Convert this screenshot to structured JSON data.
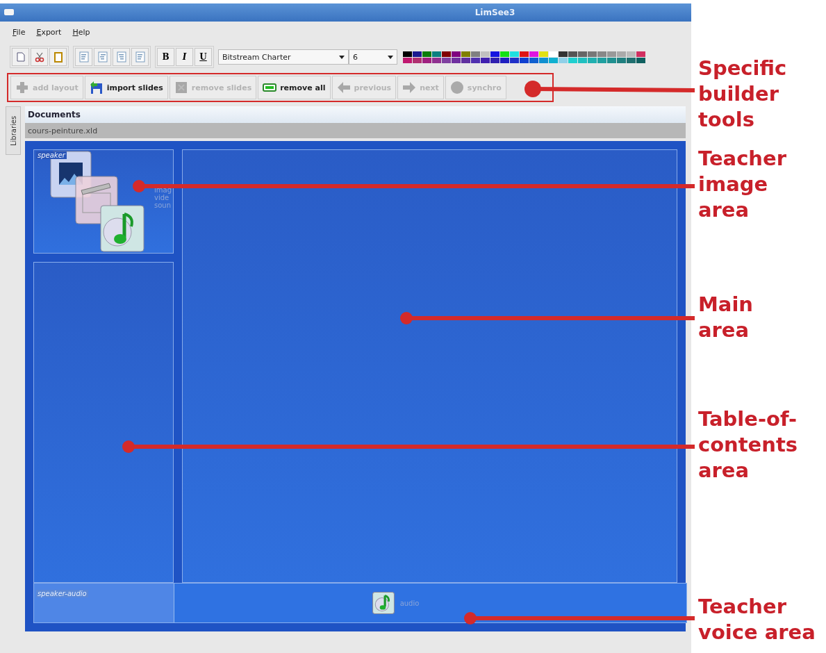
{
  "window": {
    "title": "LimSee3"
  },
  "menu": [
    {
      "label": "File"
    },
    {
      "label": "Export"
    },
    {
      "label": "Help"
    }
  ],
  "format_toolbar": {
    "font": "Bitstream Charter",
    "size": "6",
    "styles": [
      "B",
      "I",
      "U"
    ]
  },
  "builder_tools": [
    {
      "kind": "add",
      "label": "add layout",
      "disabled": true
    },
    {
      "kind": "import",
      "label": "import slides",
      "disabled": false
    },
    {
      "kind": "remove",
      "label": "remove slides",
      "disabled": true
    },
    {
      "kind": "clear",
      "label": "remove all",
      "disabled": false
    },
    {
      "kind": "previous",
      "label": "previous",
      "disabled": true
    },
    {
      "kind": "next",
      "label": "next",
      "disabled": true
    },
    {
      "kind": "sync",
      "label": "synchro",
      "disabled": true
    }
  ],
  "side_tab": "Libraries",
  "documents": {
    "title": "Documents",
    "tab": "cours-peinture.xld"
  },
  "layout": {
    "speaker_label": "speaker",
    "media_labels": [
      "imag",
      "vide",
      "soun"
    ],
    "audio_label": "speaker-audio",
    "audio_item": "audio"
  },
  "annotations": [
    {
      "text": "Specific builder tools"
    },
    {
      "text": "Teacher image area"
    },
    {
      "text": "Main area"
    },
    {
      "text": "Table-of-contents area"
    },
    {
      "text": "Teacher voice area"
    }
  ]
}
